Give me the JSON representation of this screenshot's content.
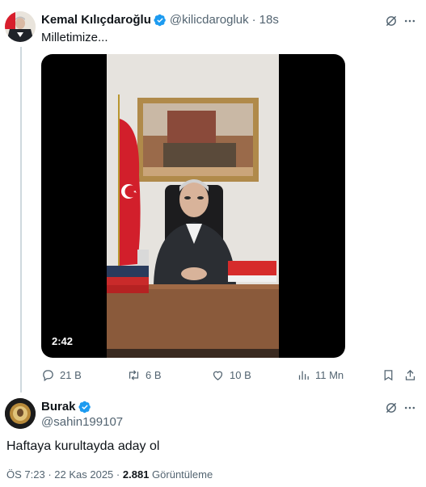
{
  "tweet": {
    "author_name": "Kemal Kılıçdaroğlu",
    "handle": "@kilicdarogluk",
    "time": "18s",
    "text": "Milletimize...",
    "video_duration": "2:42",
    "actions": {
      "replies": "21 B",
      "retweets": "6 B",
      "likes": "10 B",
      "views": "11 Mn"
    }
  },
  "reply": {
    "author_name": "Burak",
    "handle": "@sahin199107",
    "text": "Haftaya kurultayda aday ol",
    "time": "ÖS 7:23",
    "date": "22 Kas 2025",
    "views_count": "2.881",
    "views_label": "Görüntüleme"
  },
  "colors": {
    "verified": "#1d9bf0",
    "text": "#0f1419",
    "secondary": "#536471",
    "divider": "#cfd9de"
  }
}
